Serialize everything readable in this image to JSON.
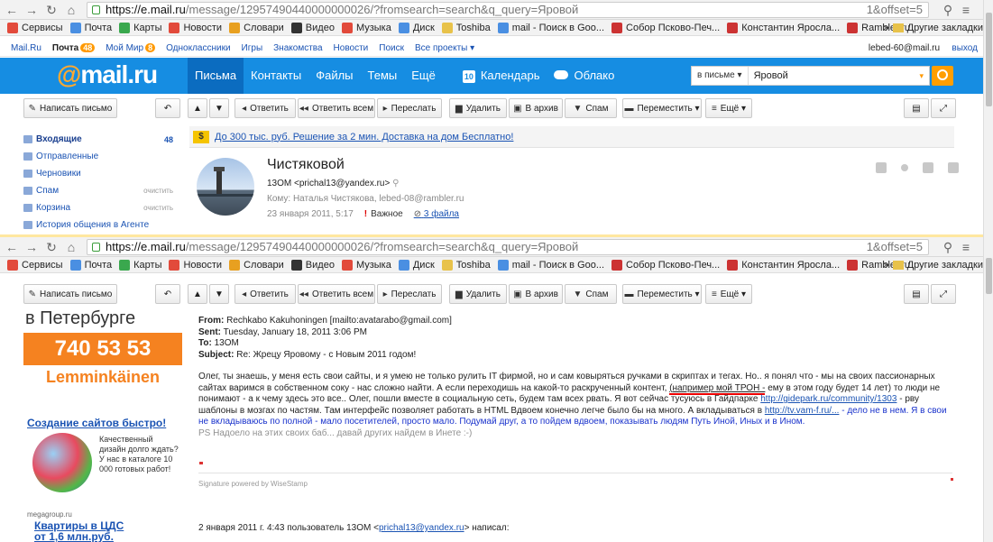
{
  "browser": {
    "url_host": "https://e.mail.ru",
    "url_rest": "/message/12957490440000000026/?fromsearch=search&q_query=Яровой",
    "url_rest_suffix": "1&offset=5",
    "bookmarks": [
      "Сервисы",
      "Почта",
      "Карты",
      "Новости",
      "Словари",
      "Видео",
      "Музыка",
      "Диск",
      "Toshiba",
      "mail - Поиск в Goo...",
      "Собор Псково-Печ...",
      "Константин Яросла...",
      "Rambler.ru"
    ],
    "bookmarks_other": "Другие закладки"
  },
  "portal": {
    "links": [
      "Mail.Ru",
      "Почта",
      "Мой Мир",
      "Одноклассники",
      "Игры",
      "Знакомства",
      "Новости",
      "Поиск",
      "Все проекты"
    ],
    "mail_badge": "48",
    "mymir_badge": "8",
    "user": "lebed-60@mail.ru",
    "logout": "выход"
  },
  "header": {
    "logo": "mail.ru",
    "nav": [
      "Письма",
      "Контакты",
      "Файлы",
      "Темы",
      "Ещё"
    ],
    "calendar": "Календарь",
    "calendar_day": "10",
    "cloud": "Облако",
    "search_scope": "в письме",
    "search_query": "Яровой"
  },
  "toolbar": {
    "compose": "Написать письмо",
    "reply": "Ответить",
    "reply_all": "Ответить всем",
    "forward": "Переслать",
    "delete": "Удалить",
    "archive": "В архив",
    "spam": "Спам",
    "move": "Переместить",
    "more": "Ещё"
  },
  "sidebar": {
    "folders": [
      {
        "label": "Входящие",
        "count": "48"
      },
      {
        "label": "Отправленные"
      },
      {
        "label": "Черновики"
      },
      {
        "label": "Спам",
        "action": "очистить"
      },
      {
        "label": "Корзина",
        "action": "очистить"
      },
      {
        "label": "История общения в Агенте"
      }
    ]
  },
  "ad_top": {
    "symbol": "$",
    "text": "До 300 тыс. руб. Решение за 2 мин. Доставка на дом Бесплатно!"
  },
  "message": {
    "subject": "Чистяковой",
    "from": "13ОМ <prichal13@yandex.ru>",
    "to_label": "Кому:",
    "to": "Наталья Чистякова, lebed-08@rambler.ru",
    "date": "23 января 2011, 5:17",
    "important_mark": "!",
    "important": "Важное",
    "files": "3 файла"
  },
  "ads_left": {
    "city": "в Петербурге",
    "phone": "740 53 53",
    "brand": "Lemminkäinen",
    "ad2_title": "Создание сайтов быстро!",
    "ad2_text": "Качественный дизайн долго ждать? У нас в каталоге 10 000 готовых работ!",
    "ad2_source": "megagroup.ru",
    "ad3_line1": "Квартиры в ЦДС",
    "ad3_line2": "от 1,6 млн.руб."
  },
  "body": {
    "from_label": "From:",
    "from_value": "Rechkabo Kakuhoningen [mailto:avatarabo@gmail.com]",
    "sent_label": "Sent:",
    "sent_value": "Tuesday, January 18, 2011 3:06 PM",
    "to_label": "To:",
    "to_value": "13ОМ",
    "subject_label": "Subject:",
    "subject_value": "Re: Жрецу Яровому - с Новым 2011 годом!",
    "p1a": "Олег, ты знаешь, у меня есть свои сайты, и я умею не только рулить IT фирмой, но и сам ковыряться ручками в скриптах и тегах. Но.. я понял что - мы на своих пассионарных сайтах варимся в собственном соку - нас сложно найти. А если переходишь на какой-то раскрученный контент, ",
    "p1_underlined": "(например мой ТРОН -",
    "p1b": " ему в этом году будет 14 лет) то люди не понимают - а к чему здесь это все.. Олег, пошли вместе в социальную сеть, будем там всех рвать. Я вот сейчас тусуюсь в Гайдпарке ",
    "p1_link1": "http://gidepark.ru/community/1303",
    "p1c": " - рву шаблоны в мозгах по частям. Там интерфейс позволяет работать в HTML Вдвоем конечно легче было бы на много. А вкладываться в ",
    "p1_link2": "http://tv.vam-f.ru/...",
    "p1d": " - дело не в нем. Я в свои не вкладываюсь по полной - мало посетителей, просто мало. Подумай друг, а то пойдем вдвоем, показывать людям Путь Иной, Иных и в Ином.",
    "p1e": "PS Надоело на этих своих баб... давай других найдем в Инете :-)",
    "signature": "Signature powered by WiseStamp",
    "quote_prefix": "2 января 2011 г. 4:43 пользователь 13ОМ <",
    "quote_email": "prichal13@yandex.ru",
    "quote_suffix": "> написал:"
  },
  "colors": {
    "header_blue": "#168de2",
    "accent_orange": "#ff9e00",
    "link_blue": "#1a53b3"
  }
}
